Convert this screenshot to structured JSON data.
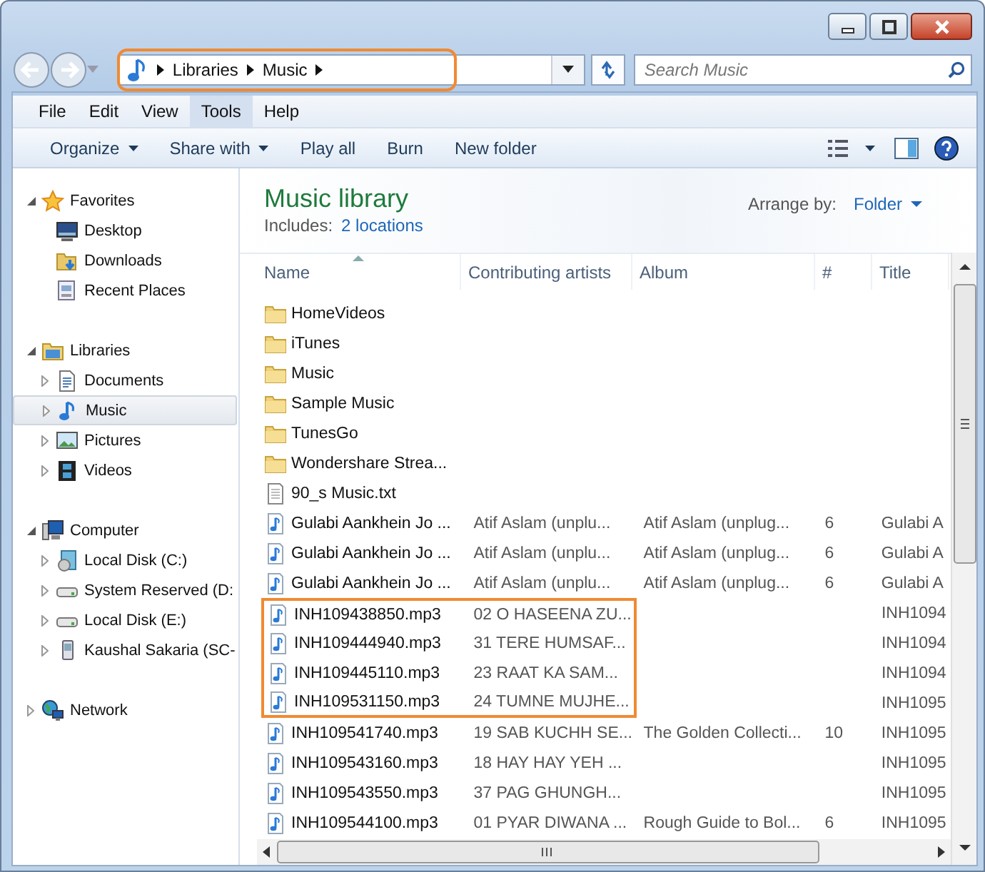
{
  "address_bar": {
    "crumbs": [
      "Libraries",
      "Music"
    ],
    "highlighted": true
  },
  "search": {
    "placeholder": "Search Music"
  },
  "menu": [
    {
      "label": "File",
      "selected": false
    },
    {
      "label": "Edit",
      "selected": false
    },
    {
      "label": "View",
      "selected": false
    },
    {
      "label": "Tools",
      "selected": true
    },
    {
      "label": "Help",
      "selected": false
    }
  ],
  "toolbar": [
    {
      "label": "Organize",
      "dropdown": true
    },
    {
      "label": "Share with",
      "dropdown": true
    },
    {
      "label": "Play all",
      "dropdown": false
    },
    {
      "label": "Burn",
      "dropdown": false
    },
    {
      "label": "New folder",
      "dropdown": false
    }
  ],
  "navigation": [
    {
      "label": "Favorites",
      "kind": "star",
      "expanded": true,
      "selected": false,
      "children": [
        {
          "label": "Desktop",
          "kind": "desktop",
          "selected": false
        },
        {
          "label": "Downloads",
          "kind": "downloads",
          "selected": false
        },
        {
          "label": "Recent Places",
          "kind": "recent",
          "selected": false
        }
      ]
    },
    {
      "label": "Libraries",
      "kind": "libraries",
      "expanded": true,
      "selected": false,
      "children": [
        {
          "label": "Documents",
          "kind": "documents",
          "expanded": false,
          "selected": false
        },
        {
          "label": "Music",
          "kind": "music",
          "expanded": false,
          "selected": true
        },
        {
          "label": "Pictures",
          "kind": "pictures",
          "expanded": false,
          "selected": false
        },
        {
          "label": "Videos",
          "kind": "videos",
          "expanded": false,
          "selected": false
        }
      ]
    },
    {
      "label": "Computer",
      "kind": "computer",
      "expanded": true,
      "selected": false,
      "children": [
        {
          "label": "Local Disk (C:)",
          "kind": "system-disk",
          "expanded": false,
          "selected": false
        },
        {
          "label": "System Reserved (D:",
          "kind": "drive",
          "expanded": false,
          "selected": false
        },
        {
          "label": "Local Disk (E:)",
          "kind": "drive",
          "expanded": false,
          "selected": false
        },
        {
          "label": "Kaushal Sakaria (SC-",
          "kind": "phone",
          "expanded": false,
          "selected": false
        }
      ]
    },
    {
      "label": "Network",
      "kind": "network",
      "expanded": false,
      "selected": false
    }
  ],
  "library": {
    "title": "Music library",
    "includes_label": "Includes:",
    "includes_link": "2 locations",
    "arrange_label": "Arrange by:",
    "arrange_value": "Folder"
  },
  "table": {
    "columns": [
      {
        "label": "Name",
        "sorted": true
      },
      {
        "label": "Contributing artists",
        "sorted": false
      },
      {
        "label": "Album",
        "sorted": false
      },
      {
        "label": "#",
        "sorted": false
      },
      {
        "label": "Title",
        "sorted": false
      }
    ],
    "rows": [
      {
        "kind": "folder",
        "highlighted": false,
        "cells": [
          "HomeVideos"
        ]
      },
      {
        "kind": "folder",
        "highlighted": false,
        "cells": [
          "iTunes"
        ]
      },
      {
        "kind": "folder",
        "highlighted": false,
        "cells": [
          "Music"
        ]
      },
      {
        "kind": "folder",
        "highlighted": false,
        "cells": [
          "Sample Music"
        ]
      },
      {
        "kind": "folder",
        "highlighted": false,
        "cells": [
          "TunesGo"
        ]
      },
      {
        "kind": "folder",
        "highlighted": false,
        "cells": [
          "Wondershare Strea..."
        ]
      },
      {
        "kind": "text",
        "highlighted": false,
        "cells": [
          "90_s Music.txt"
        ]
      },
      {
        "kind": "audio",
        "highlighted": false,
        "cells": [
          "Gulabi Aankhein Jo ...",
          "Atif Aslam (unplu...",
          "Atif Aslam (unplug...",
          "6",
          "Gulabi A"
        ]
      },
      {
        "kind": "audio",
        "highlighted": false,
        "cells": [
          "Gulabi Aankhein Jo ...",
          "Atif Aslam (unplu...",
          "Atif Aslam (unplug...",
          "6",
          "Gulabi A"
        ]
      },
      {
        "kind": "audio",
        "highlighted": false,
        "cells": [
          "Gulabi Aankhein Jo ...",
          "Atif Aslam (unplu...",
          "Atif Aslam (unplug...",
          "6",
          "Gulabi A"
        ]
      },
      {
        "kind": "audio",
        "highlighted": true,
        "cells": [
          "INH109438850.mp3",
          "02 O HASEENA ZU...",
          "",
          "",
          "INH1094"
        ]
      },
      {
        "kind": "audio",
        "highlighted": true,
        "cells": [
          "INH109444940.mp3",
          "31 TERE HUMSAF...",
          "",
          "",
          "INH1094"
        ]
      },
      {
        "kind": "audio",
        "highlighted": true,
        "cells": [
          "INH109445110.mp3",
          "23 RAAT KA SAM...",
          "",
          "",
          "INH1094"
        ]
      },
      {
        "kind": "audio",
        "highlighted": true,
        "cells": [
          "INH109531150.mp3",
          "24 TUMNE MUJHE...",
          "",
          "",
          "INH1095"
        ]
      },
      {
        "kind": "audio",
        "highlighted": false,
        "cells": [
          "INH109541740.mp3",
          "19 SAB KUCHH SE...",
          "The Golden Collecti...",
          "10",
          "INH1095"
        ]
      },
      {
        "kind": "audio",
        "highlighted": false,
        "cells": [
          "INH109543160.mp3",
          "18 HAY HAY YEH ...",
          "",
          "",
          "INH1095"
        ]
      },
      {
        "kind": "audio",
        "highlighted": false,
        "cells": [
          "INH109543550.mp3",
          "37 PAG GHUNGH...",
          "",
          "",
          "INH1095"
        ]
      },
      {
        "kind": "audio",
        "highlighted": false,
        "cells": [
          "INH109544100.mp3",
          "01 PYAR DIWANA ...",
          "Rough Guide to Bol...",
          "6",
          "INH1095"
        ]
      }
    ]
  }
}
